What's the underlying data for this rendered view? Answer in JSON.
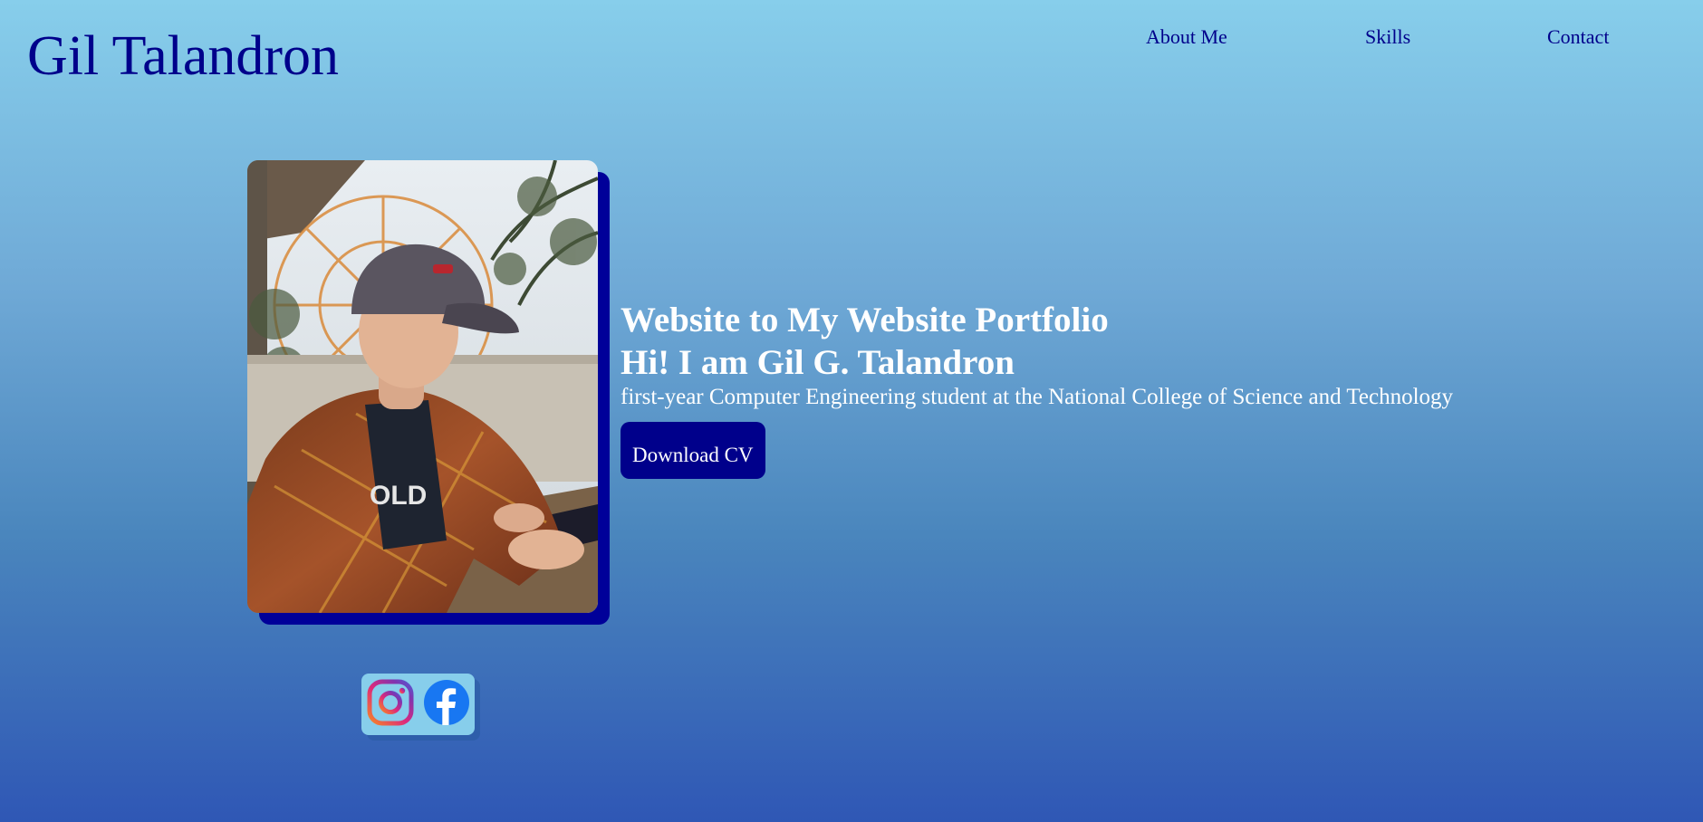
{
  "header": {
    "logo": "Gil Talandron",
    "nav": [
      "About Me",
      "Skills",
      "Contact"
    ]
  },
  "hero": {
    "headline": "Website to My Website Portfolio",
    "greeting": "Hi! I am Gil G. Talandron",
    "tagline": "first-year Computer Engineering student at the National College of Science and Technology",
    "cta_label": "Download CV"
  },
  "social": {
    "icons": [
      "instagram-icon",
      "facebook-icon"
    ]
  },
  "colors": {
    "accent": "#00008b",
    "background_top": "#87ceeb",
    "background_bottom": "#2f57b5",
    "heading_text": "#ffffff",
    "facebook": "#1877f2"
  }
}
